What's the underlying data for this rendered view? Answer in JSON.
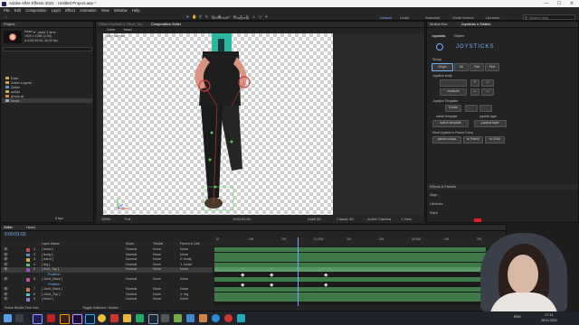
{
  "window": {
    "title": "Adobe After Effects 2021 - Untitled Project.aep *",
    "minimize": "—",
    "maximize": "☐",
    "close": "✕"
  },
  "menu": [
    "File",
    "Edit",
    "Composition",
    "Layer",
    "Effect",
    "Animation",
    "View",
    "Window",
    "Help"
  ],
  "toolbar": {
    "universal_label": "Universal",
    "snapping_label": "Snapping",
    "workspaces": [
      "Default",
      "Learn",
      "Standard",
      "Small Screen",
      "Libraries"
    ],
    "search_placeholder": "Search Help"
  },
  "project": {
    "tab": "Project",
    "selected_name": "head",
    "selected_info": "▾ , used 1 time",
    "selected_dims": "1920 x 1080 (1,00)",
    "selected_dur": "Δ 0:00:10:00, 30,00 fps",
    "items": [
      "Ears",
      "Zeller Layers",
      "Zeller",
      "solids",
      "photo.ai",
      "head"
    ],
    "footer_bpc": "8 bpc"
  },
  "effect_controls_tab": "Effect Controls 4 | Bod_Top",
  "composition": {
    "tab": "Composition Zeller",
    "subtabs": [
      "Zeller",
      "Head"
    ],
    "view_label": "Active Camera",
    "zoom": "100%",
    "quality": "Full",
    "timecode": "0:00:01:00",
    "draft": "Draft 3D",
    "renderer": "Classic 3D",
    "view_camera": "Active Camera",
    "views": "1 View",
    "exposure": "+0,0"
  },
  "right_panel": {
    "tabs": [
      "Motion Bro",
      "Joysticks n Sliders"
    ],
    "subtabs": [
      "Joysticks",
      "Sliders"
    ],
    "header": "Joysticks n Sliders",
    "logo_text": "JOYSTICKS",
    "setup_label": "Setup",
    "origin_label": "Origin",
    "all_label": "All",
    "flat_label": "Flat",
    "first_label": "First",
    "joystick_body": "Joystick body",
    "measure_label": "measure",
    "joystick_template": "Joystick Template",
    "create_label": "Create",
    "switch_template": "switch template",
    "joystick_layer": "joystick layer",
    "switch_template_value": "switch template",
    "joystick_layer_value": "joystick layer",
    "move_joystick": "Move joystick to Parent Comp",
    "parent_comps": "parent comps",
    "to_parent": "to Parent",
    "to_child": "to Child",
    "effects_presets": "Effects & Presets",
    "align": "Align",
    "libraries": "Libraries",
    "paint": "Paint"
  },
  "timeline": {
    "tabs": [
      "Zeller",
      "Head"
    ],
    "timecode": "0:00:01:00",
    "columns": {
      "layer_name": "Layer Name",
      "mode": "Mode",
      "trkmat": "TrkMat",
      "parent": "Parent & Link"
    },
    "layers": [
      {
        "num": "1",
        "name": "[ head ]",
        "mode": "Normal",
        "trk": "None",
        "par": "None",
        "color": "#c94d4d"
      },
      {
        "num": "2",
        "name": "[ body ]",
        "mode": "Normal",
        "trk": "None",
        "par": "None",
        "color": "#4d8fc9"
      },
      {
        "num": "3",
        "name": "[ hand ]",
        "mode": "Normal",
        "trk": "None",
        "par": "2. body",
        "color": "#c9b34d"
      },
      {
        "num": "4",
        "name": "[ leg ]",
        "mode": "Normal",
        "trk": "None",
        "par": "1. head",
        "color": "#4dc97a"
      },
      {
        "num": "5",
        "name": "[ Bod_Top ]",
        "mode": "Normal",
        "trk": "None",
        "par": "None",
        "color": "#9b4dc9"
      },
      {
        "num": "",
        "name": "Position",
        "mode": "",
        "trk": "",
        "par": "",
        "color": ""
      },
      {
        "num": "6",
        "name": "[ Joint_Back ]",
        "mode": "Normal",
        "trk": "None",
        "par": "None",
        "color": "#c94d9b"
      },
      {
        "num": "",
        "name": "Position",
        "mode": "",
        "trk": "",
        "par": "",
        "color": ""
      },
      {
        "num": "7",
        "name": "[ Joint_Back ]",
        "mode": "Normal",
        "trk": "None",
        "par": "None",
        "color": "#c97a4d"
      },
      {
        "num": "8",
        "name": "[ Joint_Top ]",
        "mode": "Normal",
        "trk": "None",
        "par": "4. leg",
        "color": "#4dc9c9"
      },
      {
        "num": "9",
        "name": "[ head ]",
        "mode": "Normal",
        "trk": "None",
        "par": "None",
        "color": "#7a7ac9"
      }
    ],
    "ruler": [
      "0f",
      "10f",
      "20f",
      "01:00f",
      "10f",
      "20f",
      "02:00f",
      "10f",
      "20f"
    ],
    "footer": "Toggle Switches / Modes",
    "frame_render_time": "Frame Render Time 0ms"
  },
  "webcam": {
    "label": "Webcam overlay"
  },
  "tray": {
    "time": "17:11",
    "date": "28.01.2021",
    "lang": "ENG"
  }
}
